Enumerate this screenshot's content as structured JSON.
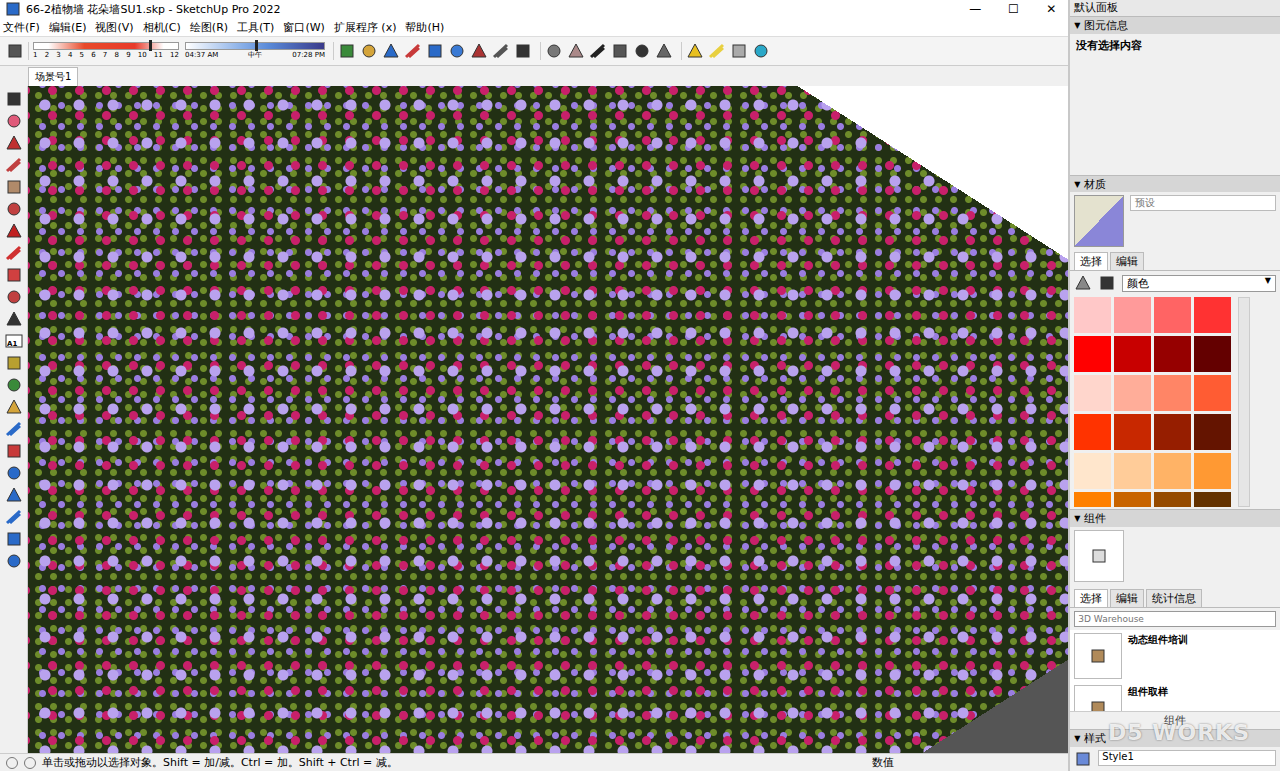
{
  "window": {
    "title": "66-2植物墙 花朵墙SU1.skp - SketchUp Pro 2022",
    "controls": [
      "—",
      "☐",
      "✕"
    ]
  },
  "panel_title": "默认面板",
  "menu": [
    "文件(F)",
    "编辑(E)",
    "视图(V)",
    "相机(C)",
    "绘图(R)",
    "工具(T)",
    "窗口(W)",
    "扩展程序 (x)",
    "帮助(H)"
  ],
  "shadow_settings": {
    "months": [
      "1",
      "2",
      "3",
      "4",
      "5",
      "6",
      "7",
      "8",
      "9",
      "10",
      "11",
      "12"
    ],
    "month_level": 0.8,
    "time_start": "04:37 AM",
    "time_mid": "中午",
    "time_end": "07:28 PM",
    "time_level": 0.5
  },
  "scene_tabs": [
    {
      "label": "场景号1",
      "selected": true
    }
  ],
  "tool_label": "A1",
  "entity_info": {
    "title": "图元信息",
    "text": "没有选择内容"
  },
  "materials": {
    "title": "材质",
    "name": "预设",
    "tabs": [
      {
        "label": "选择",
        "selected": true
      },
      {
        "label": "编辑",
        "selected": false
      }
    ],
    "library": "颜色",
    "swatches": [
      {
        "color": "#ffc8c8"
      },
      {
        "color": "#ff9a9a"
      },
      {
        "color": "#ff6464"
      },
      {
        "color": "#ff3232"
      },
      {
        "color": "#ff0000"
      },
      {
        "color": "#c80000"
      },
      {
        "color": "#960000"
      },
      {
        "color": "#640000"
      },
      {
        "color": "#ffd6cc"
      },
      {
        "color": "#ffad99"
      },
      {
        "color": "#ff8566"
      },
      {
        "color": "#ff5c33"
      },
      {
        "color": "#ff3300"
      },
      {
        "color": "#c82800"
      },
      {
        "color": "#961e00"
      },
      {
        "color": "#641400"
      },
      {
        "color": "#ffe6cc"
      },
      {
        "color": "#ffcc99"
      },
      {
        "color": "#ffb366"
      },
      {
        "color": "#ff9933"
      },
      {
        "color": "#ff8000"
      },
      {
        "color": "#c86400"
      },
      {
        "color": "#964b00"
      },
      {
        "color": "#643200"
      }
    ]
  },
  "components": {
    "title": "组件",
    "tabs": [
      {
        "label": "选择",
        "selected": true
      },
      {
        "label": "编辑",
        "selected": false
      },
      {
        "label": "统计信息",
        "selected": false
      }
    ],
    "search": {
      "placeholder": "3D Warehouse"
    },
    "items": [
      "动态组件培训",
      "组件取样"
    ],
    "footer": "组件"
  },
  "styles": {
    "title": "样式",
    "name": "Style1"
  },
  "status_bar": {
    "hint": "单击或拖动以选择对象。Shift = 加/减。Ctrl = 加。Shift + Ctrl = 减。",
    "measurements_label": "数值"
  },
  "watermark": "D5 WORKS"
}
